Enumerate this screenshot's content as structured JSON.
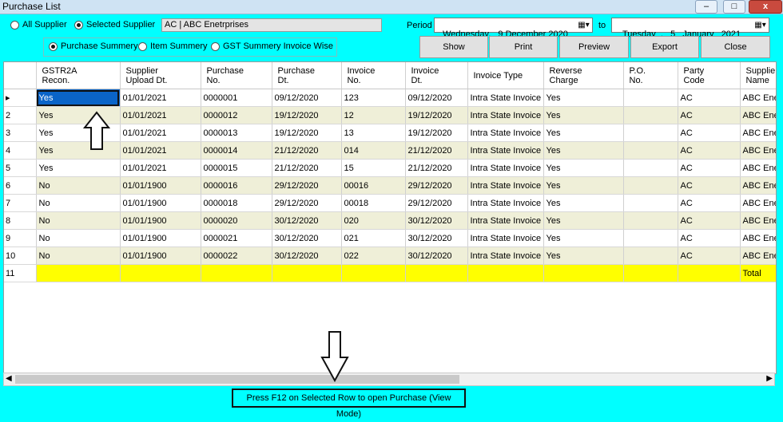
{
  "window": {
    "title": "Purchase List",
    "min_label": "–",
    "max_label": "□",
    "close_label": "x"
  },
  "filters": {
    "all_supplier": "All Supplier",
    "selected_supplier": "Selected Supplier",
    "supplier_value": "AC | ABC Enetrprises",
    "period_label": "Period",
    "from_date": "Wednesday,   9 December 2020",
    "to_label": "to",
    "to_date": " Tuesday  ,   5   January   2021",
    "purchase_summery": "Purchase Summery",
    "item_summery": "Item Summery",
    "gst_summery": "GST Summery Invoice Wise"
  },
  "buttons": {
    "show": "Show",
    "print": "Print",
    "preview": "Preview",
    "export": "Export",
    "close": "Close"
  },
  "grid": {
    "headers": [
      {
        "l1": "GSTR2A",
        "l2": "Recon."
      },
      {
        "l1": "Supplier",
        "l2": "Upload Dt."
      },
      {
        "l1": "Purchase",
        "l2": "No."
      },
      {
        "l1": "Purchase",
        "l2": "Dt."
      },
      {
        "l1": "Invoice",
        "l2": "No."
      },
      {
        "l1": "Invoice",
        "l2": "Dt."
      },
      {
        "l1": "Invoice Type",
        "l2": ""
      },
      {
        "l1": "Reverse",
        "l2": "Charge"
      },
      {
        "l1": "P.O.",
        "l2": "No."
      },
      {
        "l1": "Party",
        "l2": "Code"
      },
      {
        "l1": "Supplier",
        "l2": "Name"
      }
    ],
    "rows": [
      {
        "n": "",
        "c": [
          "Yes",
          "01/01/2021",
          "0000001",
          "09/12/2020",
          "123",
          "09/12/2020",
          "Intra State Invoice",
          "Yes",
          "",
          "AC",
          "ABC Enetrprises"
        ]
      },
      {
        "n": "2",
        "c": [
          "Yes",
          "01/01/2021",
          "0000012",
          "19/12/2020",
          "12",
          "19/12/2020",
          "Intra State Invoice",
          "Yes",
          "",
          "AC",
          "ABC Enetrprises"
        ]
      },
      {
        "n": "3",
        "c": [
          "Yes",
          "01/01/2021",
          "0000013",
          "19/12/2020",
          "13",
          "19/12/2020",
          "Intra State Invoice",
          "Yes",
          "",
          "AC",
          "ABC Enetrprises"
        ]
      },
      {
        "n": "4",
        "c": [
          "Yes",
          "01/01/2021",
          "0000014",
          "21/12/2020",
          "014",
          "21/12/2020",
          "Intra State Invoice",
          "Yes",
          "",
          "AC",
          "ABC Enetrprises"
        ]
      },
      {
        "n": "5",
        "c": [
          "Yes",
          "01/01/2021",
          "0000015",
          "21/12/2020",
          "15",
          "21/12/2020",
          "Intra State Invoice",
          "Yes",
          "",
          "AC",
          "ABC Enetrprises"
        ]
      },
      {
        "n": "6",
        "c": [
          "No",
          "01/01/1900",
          "0000016",
          "29/12/2020",
          "00016",
          "29/12/2020",
          "Intra State Invoice",
          "Yes",
          "",
          "AC",
          "ABC Enetrprises"
        ]
      },
      {
        "n": "7",
        "c": [
          "No",
          "01/01/1900",
          "0000018",
          "29/12/2020",
          "00018",
          "29/12/2020",
          "Intra State Invoice",
          "Yes",
          "",
          "AC",
          "ABC Enetrprises"
        ]
      },
      {
        "n": "8",
        "c": [
          "No",
          "01/01/1900",
          "0000020",
          "30/12/2020",
          "020",
          "30/12/2020",
          "Intra State Invoice",
          "Yes",
          "",
          "AC",
          "ABC Enetrprises"
        ]
      },
      {
        "n": "9",
        "c": [
          "No",
          "01/01/1900",
          "0000021",
          "30/12/2020",
          "021",
          "30/12/2020",
          "Intra State Invoice",
          "Yes",
          "",
          "AC",
          "ABC Enetrprises"
        ]
      },
      {
        "n": "10",
        "c": [
          "No",
          "01/01/1900",
          "0000022",
          "30/12/2020",
          "022",
          "30/12/2020",
          "Intra State Invoice",
          "Yes",
          "",
          "AC",
          "ABC Enetrprises"
        ]
      },
      {
        "n": "11",
        "c": [
          "",
          "",
          "",
          "",
          "",
          "",
          "",
          "",
          "",
          "",
          "Total"
        ]
      }
    ]
  },
  "hint": "Press F12 on Selected Row to open Purchase (View Mode)",
  "colors": {
    "background": "#00ffff",
    "selected": "#0a64c8",
    "total_row": "#ffff00",
    "alt_row": "#efefd8"
  },
  "icons": {
    "calendar": "calendar-icon",
    "row_pointer": "row-pointer-icon",
    "up_arrow": "up-arrow-icon",
    "down_arrow": "down-arrow-icon"
  }
}
